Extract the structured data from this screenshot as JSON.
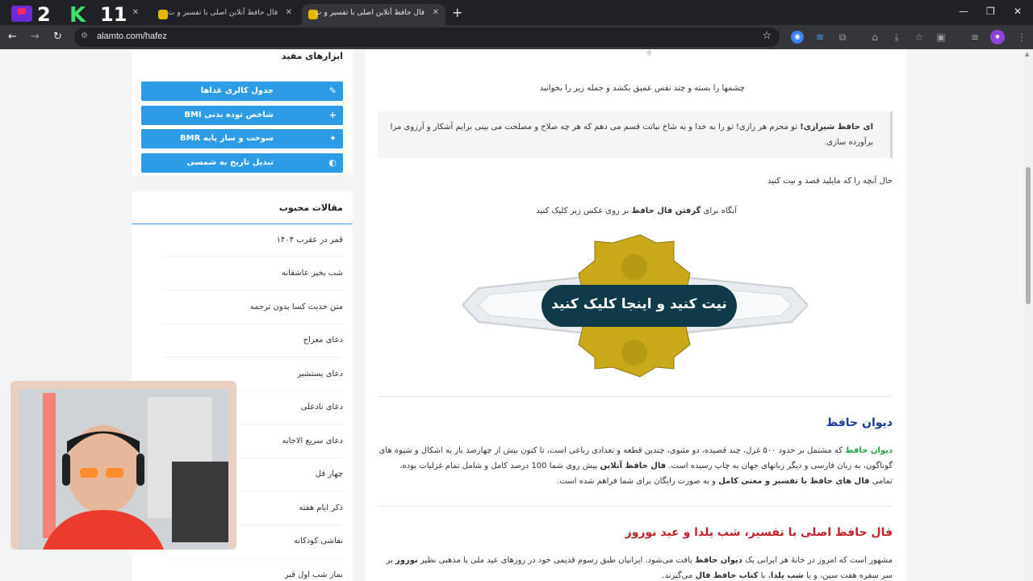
{
  "browser": {
    "tabs": [
      {
        "title": "(0) ...ها به ت"
      },
      {
        "title": "فال حافظ آنلاین اصلی با تفسیر و ت"
      },
      {
        "title": "فال حافظ آنلاین اصلی با تفسیر و ت"
      }
    ],
    "new_tab": "+",
    "url": "alamto.com/hafez",
    "overlay_logo_a": "2",
    "overlay_logo_b": "K",
    "overlay_logo_c": "11"
  },
  "sidebar": {
    "tools_title": "ابزارهای مفید",
    "tools": [
      {
        "label": "جدول کالری غذاها",
        "icon": "✎"
      },
      {
        "label": "شاخص توده بدنی BMI",
        "icon": "+"
      },
      {
        "label": "سوخت و ساز پایه BMR",
        "icon": "✦"
      },
      {
        "label": "تبدیل تاریخ به شمسی",
        "icon": "◐"
      }
    ],
    "articles_title": "مقالات محبوب",
    "articles": [
      "قمر در عقرب ۱۴۰۴",
      "شب بخیر عاشقانه",
      "متن حدیث کسا بدون ترجمه",
      "دعای معراج",
      "دعای یستشیر",
      "دعای نادعلی",
      "دعای سریع الاجابه",
      "چهار قل",
      "ذکر ایام هفته",
      "نقاشی کودکانه",
      "نماز شب اول قبر"
    ]
  },
  "main": {
    "instruction": "چشمها را بسته و چند نفس عمیق بکشد و جمله زیر را بخوانید",
    "quote_bold": "ای حافظ شیرازی!",
    "quote_rest": " تو محرم هر رازی! تو را به خدا و به شاخ نباتت قسم می دهم که هر چه صلاح و مصلحت می بینی برایم آشکار و آرزوی مرا برآورده سازی.",
    "intent": "حال آنچه را که مایلید قصد و نیت کنید",
    "click_pre": "آنگاه برای ",
    "click_bold": "گرفتن فال حافظ",
    "click_post": " بر روی عکس زیر کلیک کنید",
    "banner_text": "نیت کنید و اینجا کلیک کنید",
    "divan_heading": "دیوان حافظ",
    "divan_link": "دیوان حافظ",
    "divan_p1": " که مشتمل بر حدود ۵۰۰ غزل، چند قصیده، دو مثنوی، چندین قطعه و تعدادی رباعی است، تا کنون بیش از چهارصد بار به اشکال و شیوه های گوناگون، به زبان فارسی و دیگر زبانهای جهان به چاپ رسیده است. ",
    "divan_bold1": "فال حافظ آنلاین",
    "divan_p2": " پیش روی شما 100 درصد کامل و شامل تمام غزلیات بوده، تمامی ",
    "divan_bold2": "فال های حافظ با تفسیر و معنی کامل",
    "divan_p3": " و به صورت رایگان برای شما فراهم شده است.",
    "fal_heading": "فال حافظ اصلی با تفسیر، شب یلدا و عید نوروز",
    "fal_p1": "مشهور است که امروز در خانهٔ هر ایرانی یک ",
    "fal_bold1": "دیوان حافظ",
    "fal_p2": " یافت می‌شود. ایرانیان طبق رسوم قدیمی خود در روزهای عید ملی یا مذهبی نظیر ",
    "fal_bold2": "نوروز",
    "fal_p3": " بر سر سفره هفت سین، و یا ",
    "fal_bold3": "شب یلدا",
    "fal_p4": "، با ",
    "fal_bold4": "کتاب حافظ فال",
    "fal_p5": " می‌گیرند."
  },
  "colors": {
    "tool_button": "#2e9be6",
    "heading_blue": "#1a3a9c",
    "heading_red": "#c0232c",
    "link_green": "#2aa147",
    "banner_dark": "#0f3a4a",
    "banner_gold": "#c9a91a"
  }
}
